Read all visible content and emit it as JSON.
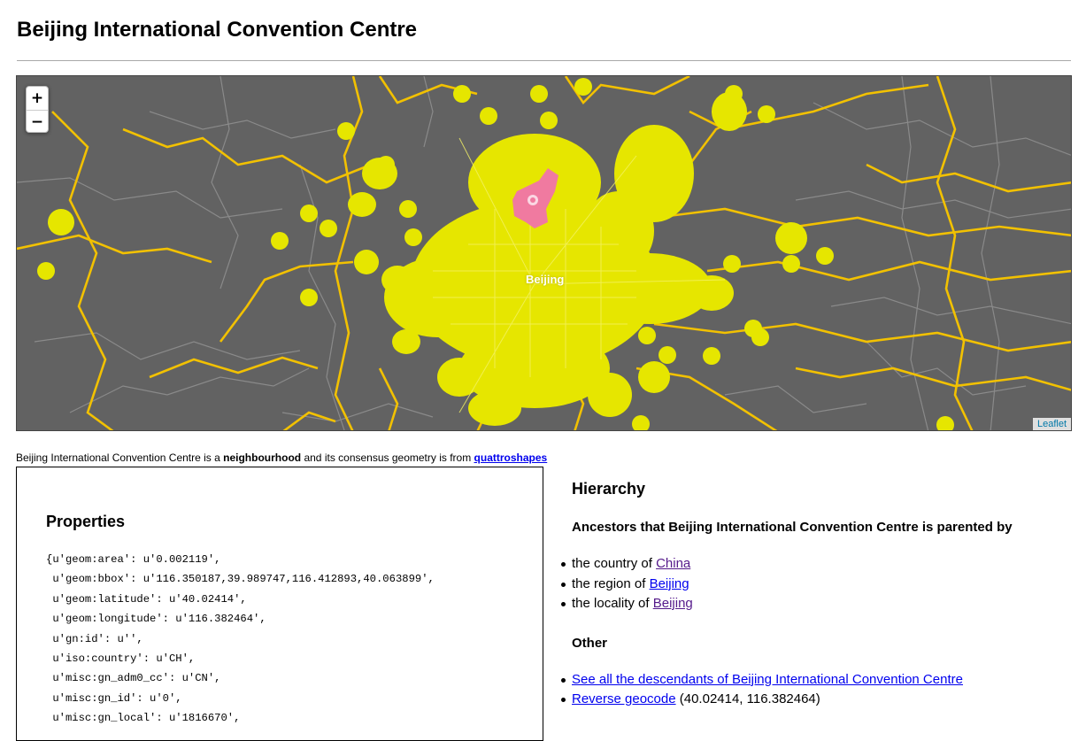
{
  "page": {
    "title": "Beijing International Convention Centre"
  },
  "map": {
    "zoom_in_label": "+",
    "zoom_out_label": "−",
    "attribution": "Leaflet",
    "city_label": "Beijing",
    "colors": {
      "background": "#626262",
      "highway": "#f2c100",
      "minor_road": "#8a8a8a",
      "neighbourhood_fill": "#e6e600",
      "selected_fill": "#f07aa0"
    }
  },
  "summary": {
    "prefix": "Beijing International Convention Centre is a ",
    "placetype": "neighbourhood",
    "middle": " and its consensus geometry is from ",
    "source": "quattroshapes"
  },
  "properties": {
    "title": "Properties",
    "lines": [
      "{u'geom:area': u'0.002119',",
      " u'geom:bbox': u'116.350187,39.989747,116.412893,40.063899',",
      " u'geom:latitude': u'40.02414',",
      " u'geom:longitude': u'116.382464',",
      " u'gn:id': u'',",
      " u'iso:country': u'CH',",
      " u'misc:gn_adm0_cc': u'CN',",
      " u'misc:gn_id': u'0',",
      " u'misc:gn_local': u'1816670',"
    ]
  },
  "hierarchy": {
    "title": "Hierarchy",
    "ancestors_heading": "Ancestors that Beijing International Convention Centre is parented by",
    "ancestors": [
      {
        "prefix": "the country of ",
        "link": "China"
      },
      {
        "prefix": "the region of ",
        "link": "Beijing"
      },
      {
        "prefix": "the locality of ",
        "link": "Beijing"
      }
    ],
    "other_heading": "Other",
    "descendants_link": "See all the descendants of Beijing International Convention Centre",
    "reverse_geocode_link": "Reverse geocode",
    "reverse_geocode_coords": "(40.02414, 116.382464)"
  }
}
